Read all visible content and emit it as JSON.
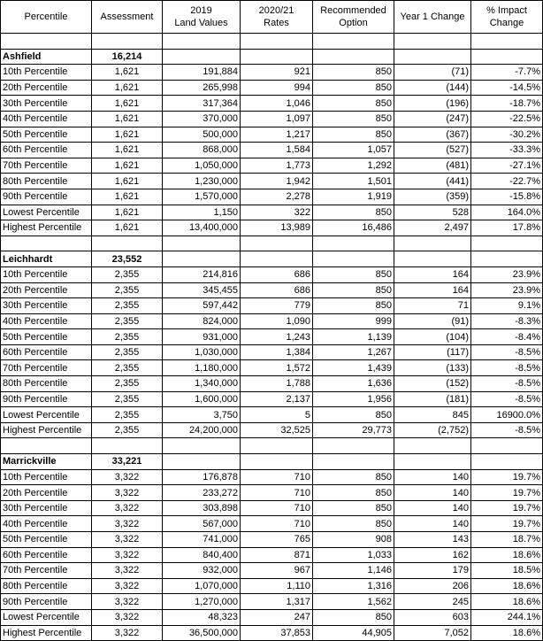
{
  "headers": [
    "Percentile",
    "Assessment",
    "2019\nLand Values",
    "2020/21\nRates",
    "Recommended\nOption",
    "Year 1 Change",
    "% Impact\nChange"
  ],
  "groups": [
    {
      "name": "Ashfield",
      "total": "16,214",
      "rows": [
        [
          "10th Percentile",
          "1,621",
          "191,884",
          "921",
          "850",
          "(71)",
          "-7.7%"
        ],
        [
          "20th Percentile",
          "1,621",
          "265,998",
          "994",
          "850",
          "(144)",
          "-14.5%"
        ],
        [
          "30th Percentile",
          "1,621",
          "317,364",
          "1,046",
          "850",
          "(196)",
          "-18.7%"
        ],
        [
          "40th Percentile",
          "1,621",
          "370,000",
          "1,097",
          "850",
          "(247)",
          "-22.5%"
        ],
        [
          "50th Percentile",
          "1,621",
          "500,000",
          "1,217",
          "850",
          "(367)",
          "-30.2%"
        ],
        [
          "60th Percentile",
          "1,621",
          "868,000",
          "1,584",
          "1,057",
          "(527)",
          "-33.3%"
        ],
        [
          "70th Percentile",
          "1,621",
          "1,050,000",
          "1,773",
          "1,292",
          "(481)",
          "-27.1%"
        ],
        [
          "80th Percentile",
          "1,621",
          "1,230,000",
          "1,942",
          "1,501",
          "(441)",
          "-22.7%"
        ],
        [
          "90th Percentile",
          "1,621",
          "1,570,000",
          "2,278",
          "1,919",
          "(359)",
          "-15.8%"
        ],
        [
          "Lowest Percentile",
          "1,621",
          "1,150",
          "322",
          "850",
          "528",
          "164.0%"
        ],
        [
          "Highest Percentile",
          "1,621",
          "13,400,000",
          "13,989",
          "16,486",
          "2,497",
          "17.8%"
        ]
      ]
    },
    {
      "name": "Leichhardt",
      "total": "23,552",
      "rows": [
        [
          "10th Percentile",
          "2,355",
          "214,816",
          "686",
          "850",
          "164",
          "23.9%"
        ],
        [
          "20th Percentile",
          "2,355",
          "345,455",
          "686",
          "850",
          "164",
          "23.9%"
        ],
        [
          "30th Percentile",
          "2,355",
          "597,442",
          "779",
          "850",
          "71",
          "9.1%"
        ],
        [
          "40th Percentile",
          "2,355",
          "824,000",
          "1,090",
          "999",
          "(91)",
          "-8.3%"
        ],
        [
          "50th Percentile",
          "2,355",
          "931,000",
          "1,243",
          "1,139",
          "(104)",
          "-8.4%"
        ],
        [
          "60th Percentile",
          "2,355",
          "1,030,000",
          "1,384",
          "1,267",
          "(117)",
          "-8.5%"
        ],
        [
          "70th Percentile",
          "2,355",
          "1,180,000",
          "1,572",
          "1,439",
          "(133)",
          "-8.5%"
        ],
        [
          "80th Percentile",
          "2,355",
          "1,340,000",
          "1,788",
          "1,636",
          "(152)",
          "-8.5%"
        ],
        [
          "90th Percentile",
          "2,355",
          "1,600,000",
          "2,137",
          "1,956",
          "(181)",
          "-8.5%"
        ],
        [
          "Lowest Percentile",
          "2,355",
          "3,750",
          "5",
          "850",
          "845",
          "16900.0%"
        ],
        [
          "Highest Percentile",
          "2,355",
          "24,200,000",
          "32,525",
          "29,773",
          "(2,752)",
          "-8.5%"
        ]
      ]
    },
    {
      "name": "Marrickville",
      "total": "33,221",
      "rows": [
        [
          "10th Percentile",
          "3,322",
          "176,878",
          "710",
          "850",
          "140",
          "19.7%"
        ],
        [
          "20th Percentile",
          "3,322",
          "233,272",
          "710",
          "850",
          "140",
          "19.7%"
        ],
        [
          "30th Percentile",
          "3,322",
          "303,898",
          "710",
          "850",
          "140",
          "19.7%"
        ],
        [
          "40th Percentile",
          "3,322",
          "567,000",
          "710",
          "850",
          "140",
          "19.7%"
        ],
        [
          "50th Percentile",
          "3,322",
          "741,000",
          "765",
          "908",
          "143",
          "18.7%"
        ],
        [
          "60th Percentile",
          "3,322",
          "840,400",
          "871",
          "1,033",
          "162",
          "18.6%"
        ],
        [
          "70th Percentile",
          "3,322",
          "932,000",
          "967",
          "1,146",
          "179",
          "18.5%"
        ],
        [
          "80th Percentile",
          "3,322",
          "1,070,000",
          "1,110",
          "1,316",
          "206",
          "18.6%"
        ],
        [
          "90th Percentile",
          "3,322",
          "1,270,000",
          "1,317",
          "1,562",
          "245",
          "18.6%"
        ],
        [
          "Lowest Percentile",
          "3,322",
          "48,323",
          "247",
          "850",
          "603",
          "244.1%"
        ],
        [
          "Highest Percentile",
          "3,322",
          "36,500,000",
          "37,853",
          "44,905",
          "7,052",
          "18.6%"
        ]
      ]
    }
  ]
}
